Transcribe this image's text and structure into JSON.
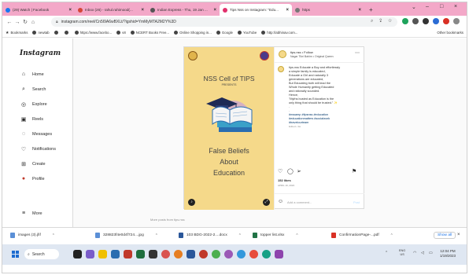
{
  "browser": {
    "tabs": [
      {
        "label": "(29) Watch | Facebook",
        "color": "#1877f2"
      },
      {
        "label": "Inbox (26) - rahul.rahimood(...",
        "color": "#d44638"
      },
      {
        "label": "Indian Express - Thu, 19 Jan ...",
        "color": "#555555"
      },
      {
        "label": "Tips Nss on Instagram: \"Edu...",
        "color": "#e1306c",
        "active": true
      },
      {
        "label": "https",
        "color": "#777777"
      }
    ],
    "new_tab": "+",
    "window_controls": [
      "⌄",
      "–",
      "□",
      "×"
    ],
    "url": "instagram.com/reel/Cn5I9A6wBXLt/?igshid=YmMyMTA2M2Y%3D",
    "bookmarks": [
      "Bookmarks",
      "newtab",
      "",
      "",
      "https://www.facebo...",
      "v8",
      "NCERT Books Free...",
      "Online Shopping in...",
      "Google",
      "YouTube",
      "http://abhinav.com..."
    ],
    "other_bookmarks": "Other bookmarks"
  },
  "instagram": {
    "logo": "Instagram",
    "nav": [
      {
        "label": "Home",
        "icon": "home-icon",
        "glyph": "⌂"
      },
      {
        "label": "Search",
        "icon": "search-icon",
        "glyph": "⌕"
      },
      {
        "label": "Explore",
        "icon": "compass-icon",
        "glyph": "◎"
      },
      {
        "label": "Reels",
        "icon": "reels-icon",
        "glyph": "▣"
      },
      {
        "label": "Messages",
        "icon": "messenger-icon",
        "glyph": "◌"
      },
      {
        "label": "Notifications",
        "icon": "heart-icon",
        "glyph": "♡"
      },
      {
        "label": "Create",
        "icon": "create-icon",
        "glyph": "⊞"
      },
      {
        "label": "Profile",
        "icon": "profile-icon",
        "glyph": "●"
      }
    ],
    "more": {
      "label": "More",
      "glyph": "≡"
    },
    "post": {
      "title": "NSS Cell of TIPS",
      "subtitle": "PRESENTS",
      "body_lines": [
        "False Beliefs",
        "About",
        "Education"
      ],
      "username": "tips.nss • Follow",
      "location": "Nagar Tikri Bahim • Original Queen",
      "caption_lines": [
        "tips.nss Educate a Boy and effortlessly",
        "a simple family is educated,",
        "Educate a Girl and naturally 3",
        "generations are educated,",
        "But Educating both will lead the",
        "Whole Humanity getting Educated",
        "and rationally sounded.",
        "Hence,",
        "\"Myths busted as Education is the",
        "only thing that should be trusted.\" ✨",
        "",
        ".",
        ".",
        "#nssamp #tipsnss #education",
        "#educationmatters #socialwork",
        "#travelourteam",
        "Edited • 3w"
      ],
      "likes": "152 likes",
      "date": "APRIL 19, 2023",
      "comment_placeholder": "Add a comment...",
      "post_button": "Post"
    },
    "more_posts": "More posts from tips.nss"
  },
  "downloads": [
    {
      "name": "images (3).jfif",
      "color": "#5b8fd6"
    },
    {
      "name": "328823f4e0d4f724....jpg",
      "color": "#5b8fd6"
    },
    {
      "name": "103 BDG-2022-2....docx",
      "color": "#2b579a"
    },
    {
      "name": "topper list.xlsx",
      "color": "#217346"
    },
    {
      "name": "ConfirmationPage-...pdf",
      "color": "#d93025"
    }
  ],
  "downloads_show_all": "Show all",
  "taskbar": {
    "search_label": "Search",
    "lang_line1": "ENG",
    "lang_line2": "US",
    "time": "12:04 PM",
    "date": "1/19/2023"
  }
}
